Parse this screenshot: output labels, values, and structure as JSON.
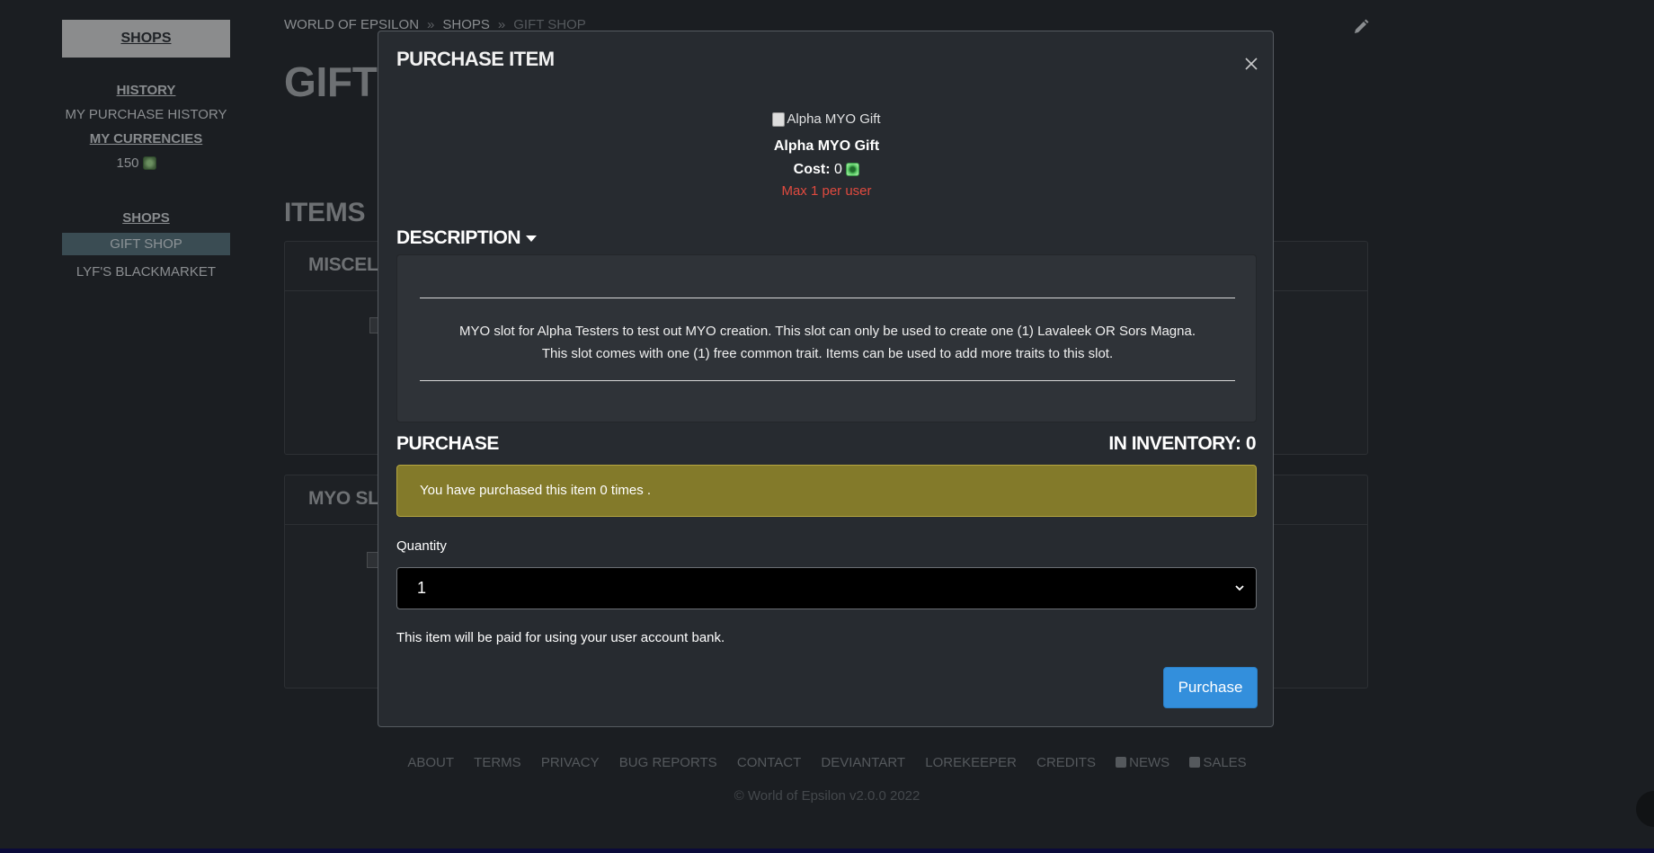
{
  "sidebar": {
    "header": "SHOPS",
    "history_heading": "HISTORY",
    "purchase_history": "MY PURCHASE HISTORY",
    "currencies_heading": "MY CURRENCIES",
    "currency_amount": "150",
    "shops_heading": "SHOPS",
    "shops": [
      "GIFT SHOP",
      "LYF'S BLACKMARKET"
    ]
  },
  "breadcrumb": {
    "items": [
      "WORLD OF EPSILON",
      "SHOPS",
      "GIFT SHOP"
    ],
    "separator": "»"
  },
  "page": {
    "title_visible": "GIFT S",
    "items_heading": "ITEMS",
    "categories": [
      "MISCELL",
      "MYO SLO"
    ]
  },
  "modal": {
    "title": "PURCHASE ITEM",
    "image_alt": "Alpha MYO Gift",
    "item_name": "Alpha MYO Gift",
    "cost_label": "Cost:",
    "cost_value": "0",
    "max_note": "Max 1 per user",
    "description_heading": "DESCRIPTION",
    "description_line1": "MYO slot for Alpha Testers to test out MYO creation. This slot can only be used to create one (1) Lavaleek OR Sors Magna.",
    "description_line2": "This slot comes with one (1) free common trait. Items can be used to add more traits to this slot.",
    "purchase_heading": "PURCHASE",
    "inventory_label": "IN INVENTORY: 0",
    "alert_text": "You have purchased this item 0 times .",
    "quantity_label": "Quantity",
    "quantity_value": "1",
    "pay_note": "This item will be paid for using your user account bank.",
    "purchase_button": "Purchase"
  },
  "footer": {
    "links": [
      "ABOUT",
      "TERMS",
      "PRIVACY",
      "BUG REPORTS",
      "CONTACT",
      "DEVIANTART",
      "LOREKEEPER",
      "CREDITS",
      "NEWS",
      "SALES"
    ],
    "copyright": "© World of Epsilon v2.0.0 2022"
  },
  "colors": {
    "background": "#1b1e22",
    "modal_bg": "#272b30",
    "alert_bg": "#837a2a",
    "button_primary": "#338fdc",
    "max_note": "#e04a3f"
  },
  "icons": [
    "edit-pencil-icon",
    "close-icon",
    "currency-gem-icon",
    "caret-down-icon",
    "chevron-down-icon",
    "rss-icon"
  ]
}
